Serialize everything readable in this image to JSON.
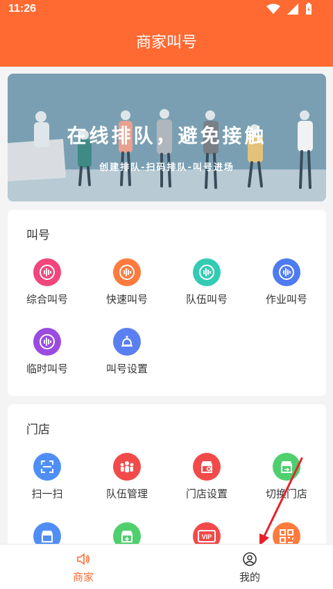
{
  "status_bar": {
    "time": "11:26"
  },
  "app_bar": {
    "title": "商家叫号"
  },
  "banner": {
    "heading": "在线排队，避免接触",
    "subheading": "创建排队-扫码排队-叫号进场"
  },
  "call_section": {
    "title": "叫号",
    "items": [
      {
        "label": "综合叫号",
        "icon": "sound-wave-icon",
        "color": "#f0467c"
      },
      {
        "label": "快速叫号",
        "icon": "sound-wave-icon",
        "color": "#ff7a3d"
      },
      {
        "label": "队伍叫号",
        "icon": "sound-wave-icon",
        "color": "#33cbb4"
      },
      {
        "label": "作业叫号",
        "icon": "sound-wave-icon",
        "color": "#4f7bf0"
      },
      {
        "label": "临时叫号",
        "icon": "sound-wave-icon",
        "color": "#9b4be0"
      },
      {
        "label": "叫号设置",
        "icon": "bell-icon",
        "color": "#5a7ff0"
      }
    ]
  },
  "store_section": {
    "title": "门店",
    "items": [
      {
        "label": "扫一扫",
        "icon": "scan-icon",
        "color": "#4f8ff5"
      },
      {
        "label": "队伍管理",
        "icon": "team-icon",
        "color": "#f24a4a"
      },
      {
        "label": "门店设置",
        "icon": "store-settings-icon",
        "color": "#f24a4a"
      },
      {
        "label": "切换门店",
        "icon": "store-switch-icon",
        "color": "#4fcf6e"
      }
    ],
    "partial_items": [
      {
        "icon": "store-icon",
        "color": "#4f8ff5"
      },
      {
        "icon": "store-add-icon",
        "color": "#4fcf6e"
      },
      {
        "icon": "vip-icon",
        "color": "#f24a4a"
      },
      {
        "icon": "qrcode-icon",
        "color": "#ff7a3d"
      }
    ]
  },
  "tab_bar": {
    "tabs": [
      {
        "label": "商家",
        "icon": "speaker-icon",
        "active": true
      },
      {
        "label": "我的",
        "icon": "user-icon",
        "active": false
      }
    ]
  },
  "colors": {
    "primary": "#ff6a33",
    "background": "#f4f4f4",
    "annotation": "#e8202a"
  }
}
